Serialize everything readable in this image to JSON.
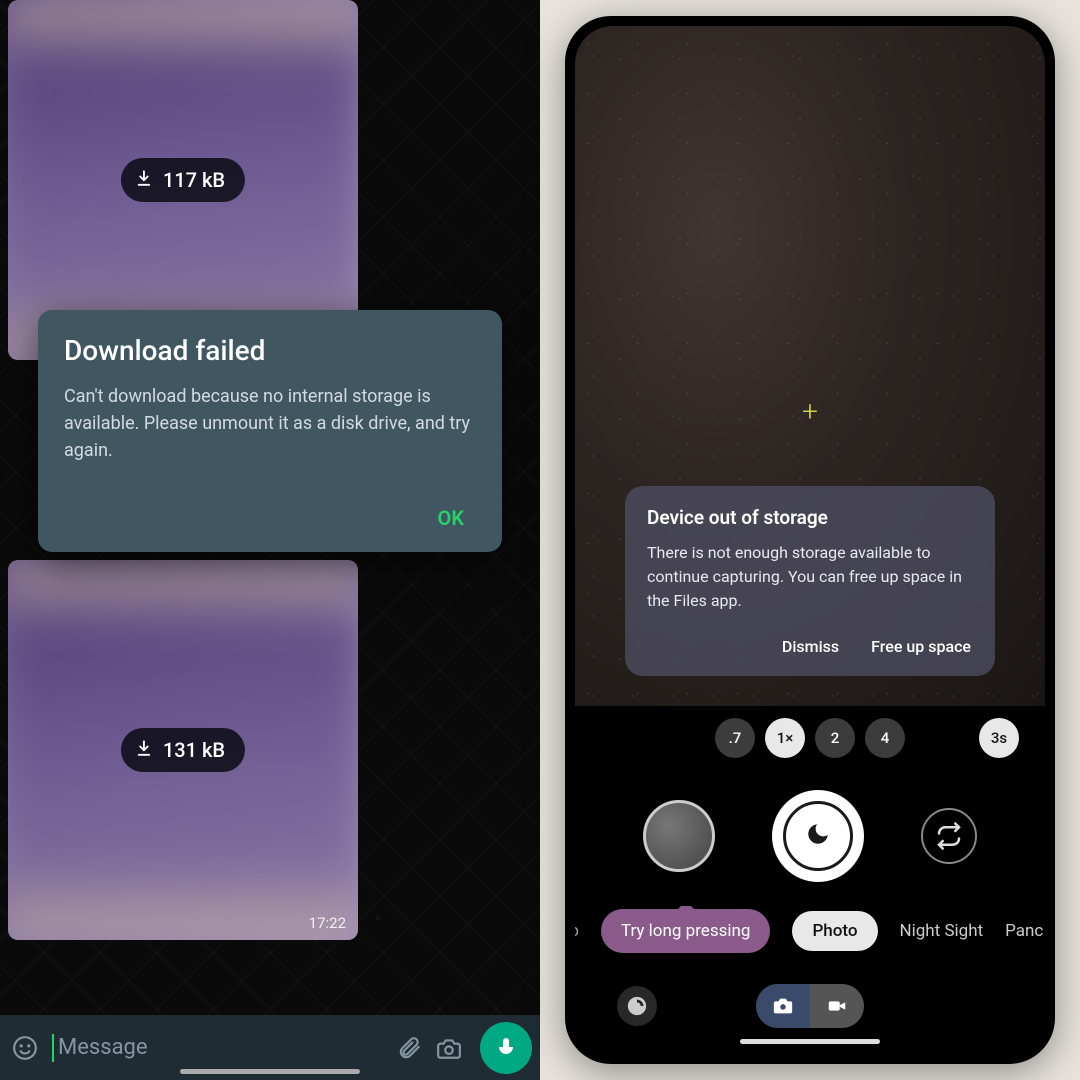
{
  "left": {
    "bubbles": [
      {
        "size": "117 kB"
      },
      {
        "size": "131 kB",
        "time": "17:22"
      }
    ],
    "dialog": {
      "title": "Download failed",
      "body": "Can't download because no internal storage is available. Please unmount it as a disk drive, and try again.",
      "ok": "OK"
    },
    "input": {
      "placeholder": "Message"
    }
  },
  "right": {
    "dialog": {
      "title": "Device out of storage",
      "body": "There is not enough storage available to continue capturing. You can free up space in the Files app.",
      "dismiss": "Dismiss",
      "free": "Free up space"
    },
    "zoom": {
      "z0": ".7",
      "z1": "1×",
      "z2": "2",
      "z3": "4",
      "timer": "3s"
    },
    "hint": "Try long pressing",
    "modes": {
      "clipped_left": "xp",
      "active": "Photo",
      "night": "Night Sight",
      "pano": "Panc"
    }
  }
}
